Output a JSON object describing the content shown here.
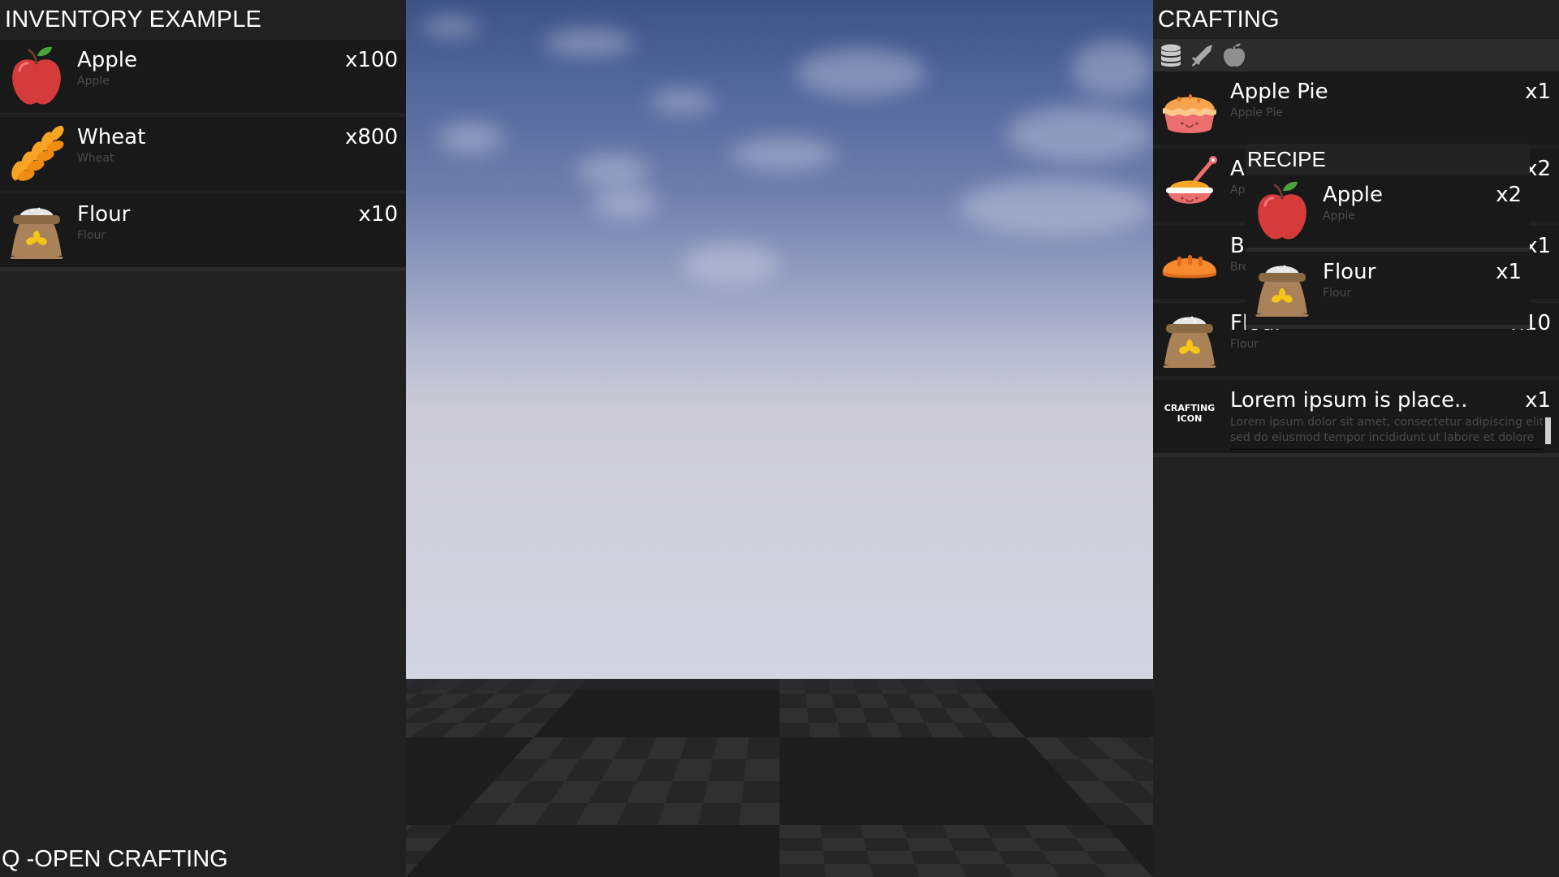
{
  "inventory": {
    "title": "INVENTORY EXAMPLE",
    "items": [
      {
        "name": "Apple",
        "subtitle": "Apple",
        "quantity": "x100",
        "icon": "apple-icon"
      },
      {
        "name": "Wheat",
        "subtitle": "Wheat",
        "quantity": "x800",
        "icon": "wheat-icon"
      },
      {
        "name": "Flour",
        "subtitle": "Flour",
        "quantity": "x10",
        "icon": "flour-sack-icon"
      }
    ],
    "hint": "Q -OPEN CRAFTING"
  },
  "crafting": {
    "title": "CRAFTING",
    "tabs": [
      {
        "icon": "resources-stack-icon",
        "selected": true
      },
      {
        "icon": "sword-icon",
        "selected": false
      },
      {
        "icon": "apple-food-icon",
        "selected": false
      }
    ],
    "items": [
      {
        "name": "Apple Pie",
        "subtitle": "Apple Pie",
        "quantity": "x1",
        "icon": "apple-pie-icon"
      },
      {
        "name": "A",
        "subtitle": "Ap",
        "quantity": "x2",
        "icon": "porridge-bowl-icon"
      },
      {
        "name": "B",
        "subtitle": "Bre",
        "quantity": "x1",
        "icon": "bread-icon"
      },
      {
        "name": "Flour",
        "subtitle": "Flour",
        "quantity": "x10",
        "icon": "flour-sack-icon"
      },
      {
        "name": "Lorem ipsum is place..",
        "description_line1": "Lorem ipsum dolor sit amet, consectetur adipiscing elit,",
        "description_line2": "sed do eiusmod tempor incididunt ut labore et dolore",
        "quantity": "x1",
        "icon_text_line1": "CRAFTING",
        "icon_text_line2": "ICON"
      }
    ]
  },
  "recipe": {
    "title": "RECIPE",
    "ingredients": [
      {
        "name": "Apple",
        "subtitle": "Apple",
        "quantity": "x2",
        "icon": "apple-icon"
      },
      {
        "name": "Flour",
        "subtitle": "Flour",
        "quantity": "x1",
        "icon": "flour-sack-icon"
      }
    ]
  }
}
